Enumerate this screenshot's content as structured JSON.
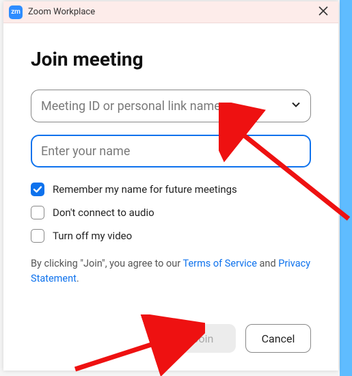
{
  "window": {
    "app_icon_text": "zm",
    "title": "Zoom Workplace"
  },
  "heading": "Join meeting",
  "fields": {
    "meeting_id_placeholder": "Meeting ID or personal link name",
    "name_placeholder": "Enter your name"
  },
  "checkboxes": {
    "remember": {
      "label": "Remember my name for future meetings",
      "checked": true
    },
    "no_audio": {
      "label": "Don't connect to audio",
      "checked": false
    },
    "no_video": {
      "label": "Turn off my video",
      "checked": false
    }
  },
  "legal": {
    "prefix": "By clicking \"Join\", you agree to our ",
    "tos": "Terms of Service",
    "middle": " and ",
    "privacy": "Privacy Statement",
    "suffix": "."
  },
  "buttons": {
    "join": "Join",
    "cancel": "Cancel"
  },
  "annotations": {
    "arrow1_target": "meeting-id-input",
    "arrow2_target": "join-button"
  }
}
